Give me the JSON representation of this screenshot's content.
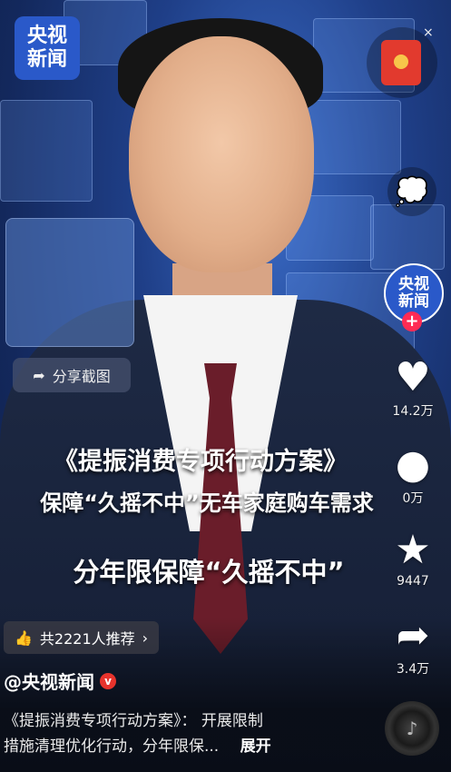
{
  "logo": {
    "line1": "央视",
    "line2": "新闻"
  },
  "close_symbol": "×",
  "share_screenshot": {
    "icon": "share-arrow-icon",
    "label": "分享截图"
  },
  "right_rail": {
    "avatar": {
      "line1": "央视",
      "line2": "新闻",
      "follow": "+"
    },
    "like": {
      "icon": "heart-icon",
      "count": "14.2万"
    },
    "comment": {
      "icon": "comment-icon",
      "count": "0万"
    },
    "favorite": {
      "icon": "star-icon",
      "count": "9447"
    },
    "share": {
      "icon": "share-icon",
      "count": "3.4万"
    }
  },
  "captions": {
    "line1": "《提振消费专项行动方案》",
    "line2": "保障“久摇不中”无车家庭购车需求",
    "line3": "分年限保障“久摇不中”"
  },
  "recommend": {
    "icon": "thumbs-up-icon",
    "label": "共2221人推荐",
    "chevron": "›"
  },
  "author": {
    "name": "@央视新闻",
    "badge": "v"
  },
  "description": {
    "line1": "《提振消费专项行动方案》： 开展限制",
    "line2": "措施清理优化行动，分年限保...",
    "expand": "展开"
  },
  "colors": {
    "accent_red": "#ff2b54",
    "brand_blue": "#2a59c9"
  }
}
